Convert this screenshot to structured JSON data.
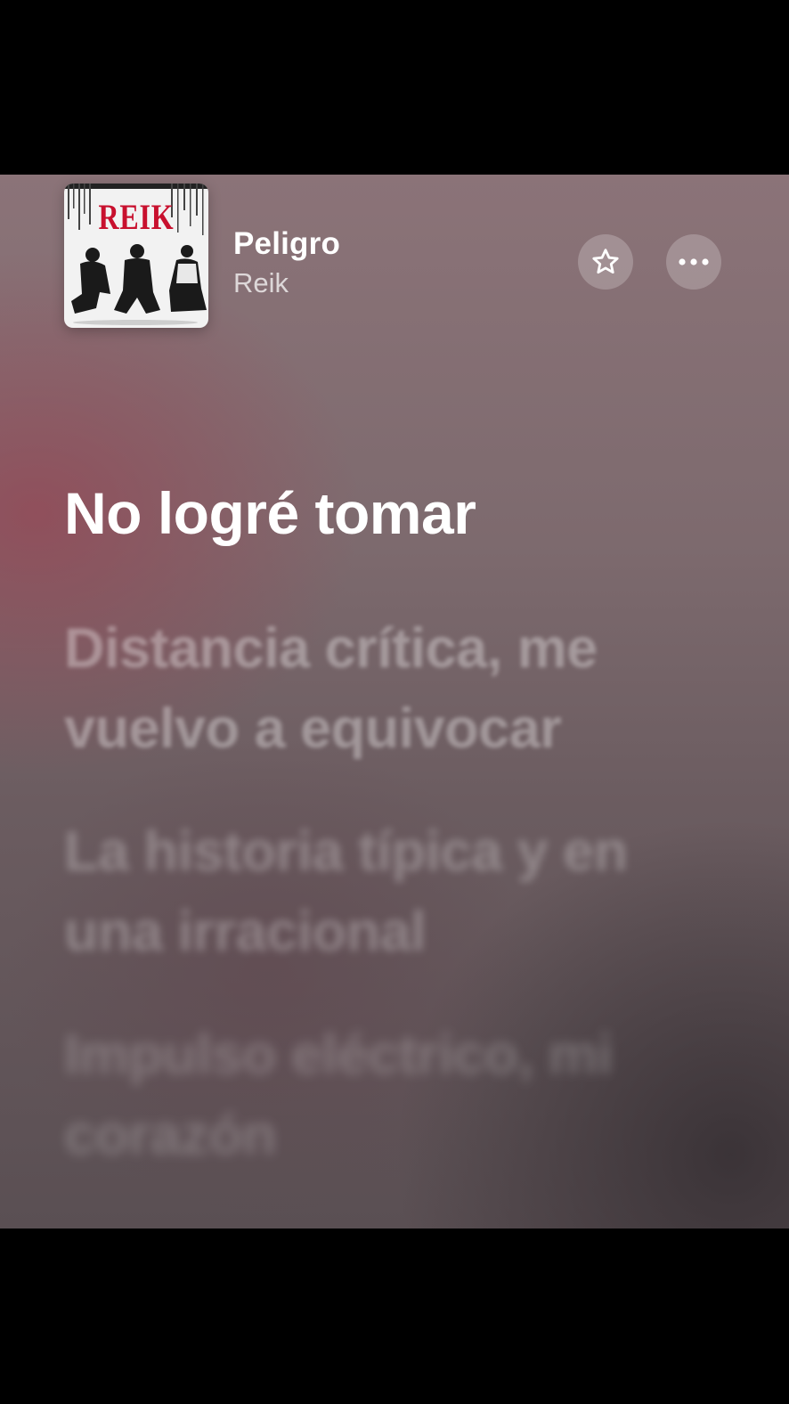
{
  "now_playing": {
    "title": "Peligro",
    "artist": "Reik",
    "artwork_text": "REIK",
    "actions": {
      "favorite_icon": "star-icon",
      "more_icon": "ellipsis-icon"
    }
  },
  "lyrics": {
    "current_line": "No logré tomar",
    "upcoming_lines": [
      "Distancia crítica, me vuelvo a equivocar",
      "La historia típica y en una irracional",
      "Impulso eléctrico, mi corazón"
    ]
  },
  "colors": {
    "background_top": "#8b7378",
    "background_bottom": "#5a4f53",
    "accent_red": "#c8102e",
    "text_primary": "#ffffff"
  }
}
